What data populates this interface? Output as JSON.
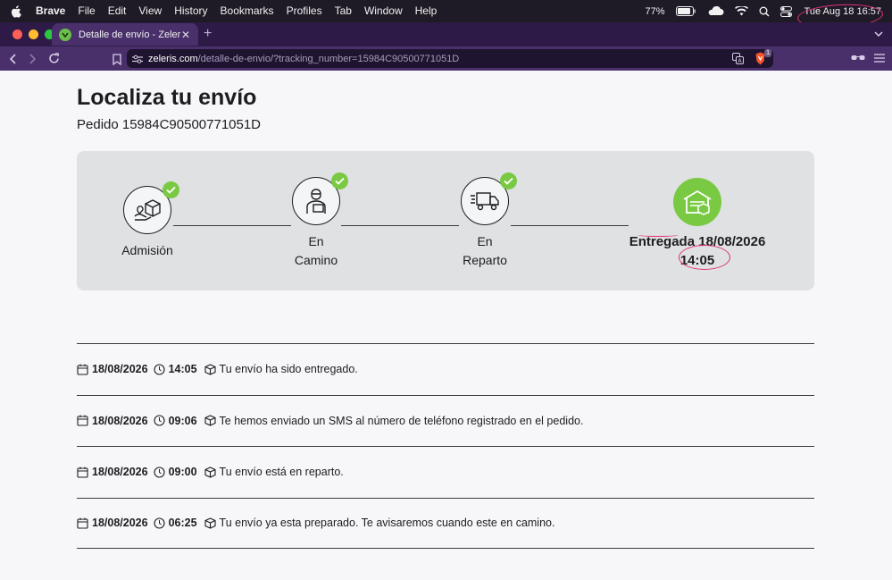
{
  "menubar": {
    "app": "Brave",
    "items": [
      "File",
      "Edit",
      "View",
      "History",
      "Bookmarks",
      "Profiles",
      "Tab",
      "Window",
      "Help"
    ],
    "battery": "77%",
    "clock": "Tue Aug 18  16:57"
  },
  "browser": {
    "tab_title": "Detalle de envío - Zeleris",
    "url_domain": "zeleris.com",
    "url_path": "/detalle-de-envio/?tracking_number=15984C90500771051D",
    "shield_count": "1"
  },
  "page": {
    "title": "Localiza tu envío",
    "order": "Pedido 15984C90500771051D",
    "steps": [
      {
        "label": "Admisión",
        "icon": "box-hand-icon"
      },
      {
        "label": "En Camino",
        "icon": "courier-icon"
      },
      {
        "label": "En Reparto",
        "icon": "truck-icon"
      },
      {
        "label_line1": "Entregada 18/08/2026",
        "label_line2": "14:05",
        "icon": "warehouse-icon"
      }
    ],
    "events": [
      {
        "date": "18/08/2026",
        "time": "14:05",
        "text": "Tu envío ha sido entregado."
      },
      {
        "date": "18/08/2026",
        "time": "09:06",
        "text": "Te hemos enviado un SMS al número de teléfono registrado en el pedido."
      },
      {
        "date": "18/08/2026",
        "time": "09:00",
        "text": "Tu envío está en reparto."
      },
      {
        "date": "18/08/2026",
        "time": "06:25",
        "text": "Tu envío ya esta preparado. Te avisaremos cuando este en camino."
      }
    ]
  },
  "colors": {
    "accent_green": "#7ac943",
    "annotation_pink": "#e0337a",
    "browser_purple": "#49306b"
  }
}
